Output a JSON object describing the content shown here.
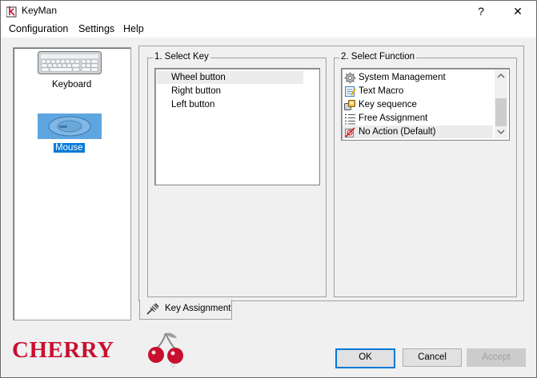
{
  "window": {
    "title": "KeyMan",
    "help_glyph": "?",
    "close_glyph": "✕"
  },
  "menu": {
    "items": [
      "Configuration",
      "Settings",
      "Help"
    ]
  },
  "devices": [
    {
      "label": "Keyboard",
      "selected": false,
      "icon": "keyboard-icon"
    },
    {
      "label": "Mouse",
      "selected": true,
      "icon": "mouse-icon"
    }
  ],
  "select_key": {
    "caption": "1. Select Key",
    "items": [
      "Wheel button",
      "Right button",
      "Left button"
    ],
    "selected_index": 0
  },
  "select_function": {
    "caption": "2. Select Function",
    "items": [
      {
        "label": "System Management",
        "icon": "gear-icon"
      },
      {
        "label": "Text Macro",
        "icon": "notepad-icon"
      },
      {
        "label": "Key sequence",
        "icon": "keys-icon"
      },
      {
        "label": "Free Assignment",
        "icon": "list-icon"
      },
      {
        "label": "No Action (Default)",
        "icon": "no-action-icon"
      }
    ],
    "selected_index": 4
  },
  "tab": {
    "label": "Key Assignment",
    "icon": "key-assignment-icon"
  },
  "brand": {
    "logo_text": "CHERRY",
    "color": "#c8102e"
  },
  "buttons": {
    "ok": "OK",
    "cancel": "Cancel",
    "accept": "Accept"
  },
  "colors": {
    "selection": "#0078d7",
    "window_bg": "#f0f0f0"
  }
}
